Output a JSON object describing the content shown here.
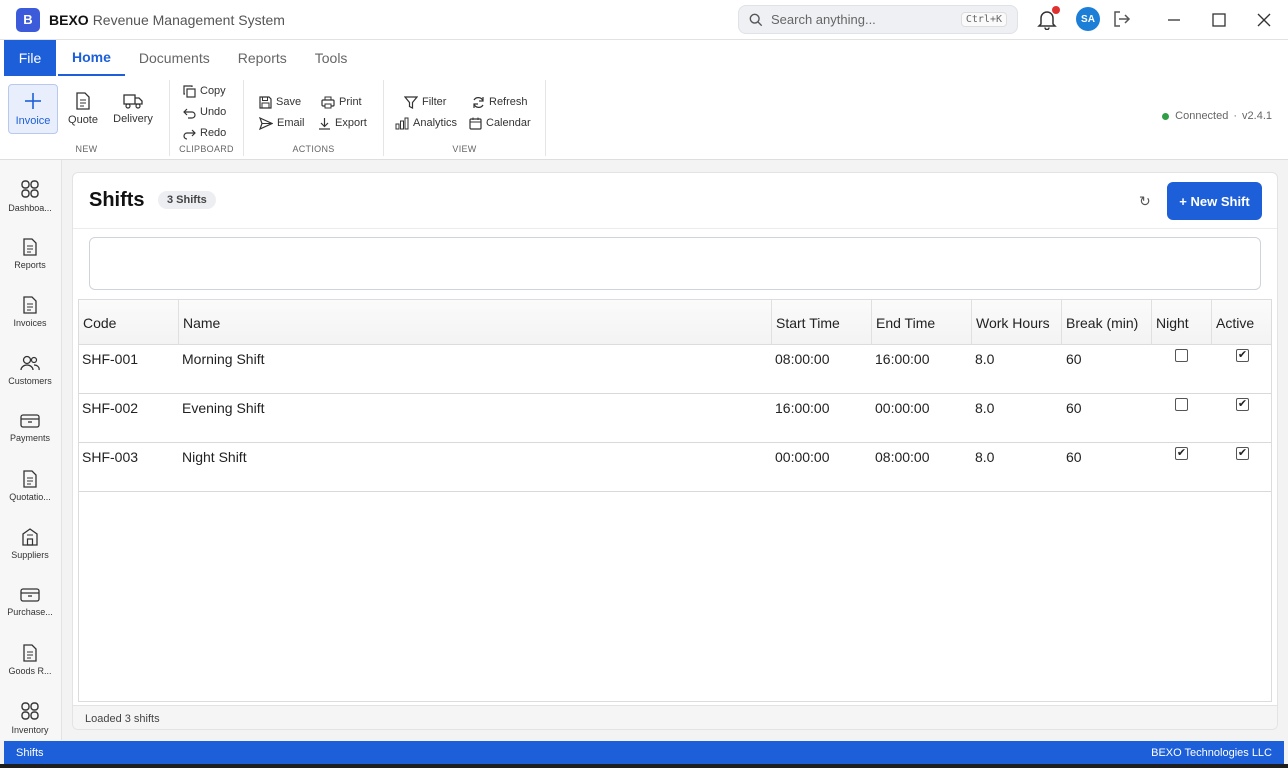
{
  "app": {
    "logo_letter": "B",
    "name": "BEXO",
    "subtitle": "Revenue Management System"
  },
  "search": {
    "placeholder": "Search anything...",
    "shortcut": "Ctrl+K"
  },
  "user": {
    "initials": "SA"
  },
  "menu": {
    "file": "File",
    "tabs": [
      "Home",
      "Documents",
      "Reports",
      "Tools"
    ]
  },
  "ribbon": {
    "groups": {
      "new": "NEW",
      "clipboard": "CLIPBOARD",
      "actions": "ACTIONS",
      "view": "VIEW"
    },
    "new": {
      "invoice": "Invoice",
      "quote": "Quote",
      "delivery": "Delivery"
    },
    "clipboard": {
      "copy": "Copy",
      "undo": "Undo",
      "redo": "Redo"
    },
    "actions": {
      "save": "Save",
      "print": "Print",
      "email": "Email",
      "export": "Export"
    },
    "view": {
      "filter": "Filter",
      "refresh": "Refresh",
      "analytics": "Analytics",
      "calendar": "Calendar"
    },
    "status": {
      "connected": "Connected",
      "separator": "·",
      "version": "v2.4.1"
    }
  },
  "sidebar": {
    "items": [
      "Dashboard",
      "Reports",
      "Invoices",
      "Customers",
      "Payments",
      "Quotations",
      "Suppliers",
      "Purchases",
      "Goods Received",
      "Inventory"
    ],
    "display": [
      "Dashboa...",
      "Reports",
      "Invoices",
      "Customers",
      "Payments",
      "Quotatio...",
      "Suppliers",
      "Purchase...",
      "Goods R...",
      "Inventory"
    ]
  },
  "page": {
    "title": "Shifts",
    "count_badge": "3 Shifts",
    "refresh_glyph": "↻",
    "new_button": "+  New Shift",
    "footer": "Loaded 3 shifts"
  },
  "table": {
    "columns": [
      "Code",
      "Name",
      "Start Time",
      "End Time",
      "Work Hours",
      "Break (min)",
      "Night",
      "Active"
    ],
    "rows": [
      {
        "code": "SHF-001",
        "name": "Morning Shift",
        "start": "08:00:00",
        "end": "16:00:00",
        "hours": "8.0",
        "break": "60",
        "night": false,
        "active": true
      },
      {
        "code": "SHF-002",
        "name": "Evening Shift",
        "start": "16:00:00",
        "end": "00:00:00",
        "hours": "8.0",
        "break": "60",
        "night": false,
        "active": true
      },
      {
        "code": "SHF-003",
        "name": "Night Shift",
        "start": "00:00:00",
        "end": "08:00:00",
        "hours": "8.0",
        "break": "60",
        "night": true,
        "active": true
      }
    ]
  },
  "statusbar": {
    "left": "Shifts",
    "right": "BEXO Technologies LLC"
  },
  "colors": {
    "accent": "#1c5fd8",
    "connected": "#2f9e44",
    "notification": "#e03131"
  }
}
